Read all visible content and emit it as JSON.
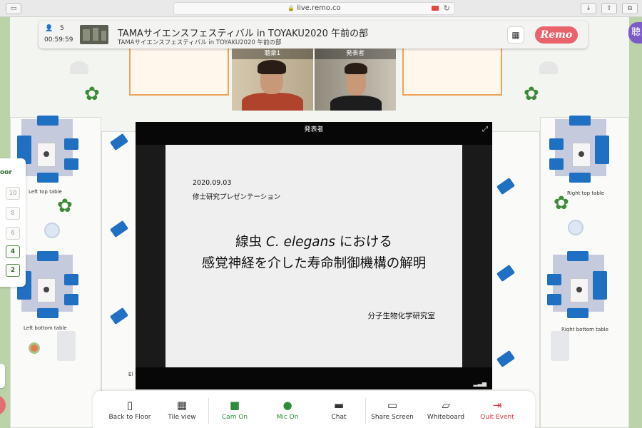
{
  "browser": {
    "url": "live.remo.co"
  },
  "event": {
    "attendee_count": "5",
    "timer": "00:59:59",
    "title": "TAMAサイエンスフェスティバル in TOYAKU2020 午前の部",
    "subtitle": "TAMAサイエンスフェスティバル in TOYAKU2020 午前の部",
    "brand": "Remo"
  },
  "right_avatar_char": "聴",
  "video_tiles": [
    {
      "name": "聴衆1"
    },
    {
      "name": "発表者"
    }
  ],
  "presenter": {
    "header": "発表者",
    "slide": {
      "date": "2020.09.03",
      "kind": "修士研究プレゼンテーション",
      "title_line1_pre": "線虫 ",
      "title_line1_italic": "C. elegans",
      "title_line1_post": " における",
      "title_line2": "感覚神経を介した寿命制御機構の解明",
      "lab": "分子生物化学研究室"
    }
  },
  "floor_panel": {
    "header": "oor",
    "floors": [
      {
        "label": "10",
        "active": false
      },
      {
        "label": "8",
        "active": false
      },
      {
        "label": "6",
        "active": false
      },
      {
        "label": "4",
        "active": true
      },
      {
        "label": "2",
        "active": true
      }
    ]
  },
  "tables": {
    "left_top": "Left top table",
    "left_bottom": "Left bottom table",
    "right_top": "Right top table",
    "right_bottom": "Right bottom table",
    "partial_el": "El"
  },
  "toolbar": {
    "back_to_floor": "Back to Floor",
    "tile_view": "Tile view",
    "cam_on": "Cam On",
    "mic_on": "Mic On",
    "chat": "Chat",
    "share_screen": "Share Screen",
    "whiteboard": "Whiteboard",
    "quit_event": "Quit Event"
  },
  "colors": {
    "cam_mic_green": "#2e8b3a",
    "quit_red": "#d9363e",
    "remo_pink": "#e8636b",
    "chair_blue": "#1f6fc2"
  }
}
